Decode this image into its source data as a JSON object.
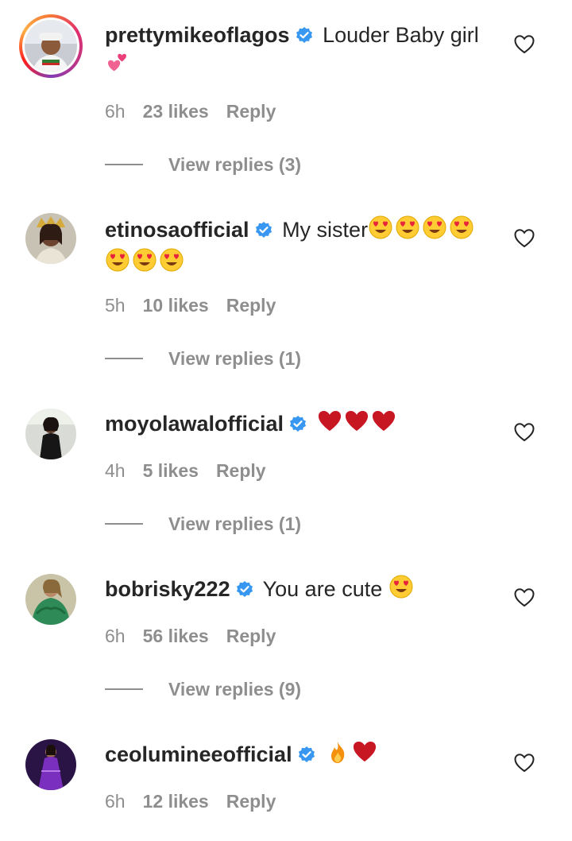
{
  "comments": [
    {
      "username": "prettymikeoflagos",
      "text": "Louder Baby girl",
      "emojis": [
        "two-hearts"
      ],
      "time": "6h",
      "likes": "23 likes",
      "reply": "Reply",
      "view_replies": "View replies (3)",
      "avatar": "avatar-white-cap-man",
      "story_ring": true
    },
    {
      "username": "etinosaofficial",
      "text": "My sister",
      "emojis": [
        "heart-eyes",
        "heart-eyes",
        "heart-eyes",
        "heart-eyes",
        "heart-eyes",
        "heart-eyes",
        "heart-eyes"
      ],
      "time": "5h",
      "likes": "10 likes",
      "reply": "Reply",
      "view_replies": "View replies (1)",
      "avatar": "avatar-crowned-woman"
    },
    {
      "username": "moyolawalofficial",
      "text": "",
      "emojis": [
        "red-heart",
        "red-heart",
        "red-heart"
      ],
      "time": "4h",
      "likes": "5 likes",
      "reply": "Reply",
      "view_replies": "View replies (1)",
      "avatar": "avatar-woman-dark-dress"
    },
    {
      "username": "bobrisky222",
      "text": "You are cute",
      "emojis": [
        "heart-eyes"
      ],
      "time": "6h",
      "likes": "56 likes",
      "reply": "Reply",
      "view_replies": "View replies (9)",
      "avatar": "avatar-woman-green-dress"
    },
    {
      "username": "ceolumineeofficial",
      "text": "",
      "emojis": [
        "fire",
        "red-heart"
      ],
      "time": "6h",
      "likes": "12 likes",
      "reply": "Reply",
      "avatar": "avatar-woman-purple-gown"
    }
  ],
  "colors": {
    "text": "#262626",
    "meta": "#8e8e8e",
    "verified": "#3897f0",
    "red_heart": "#e0245e"
  }
}
